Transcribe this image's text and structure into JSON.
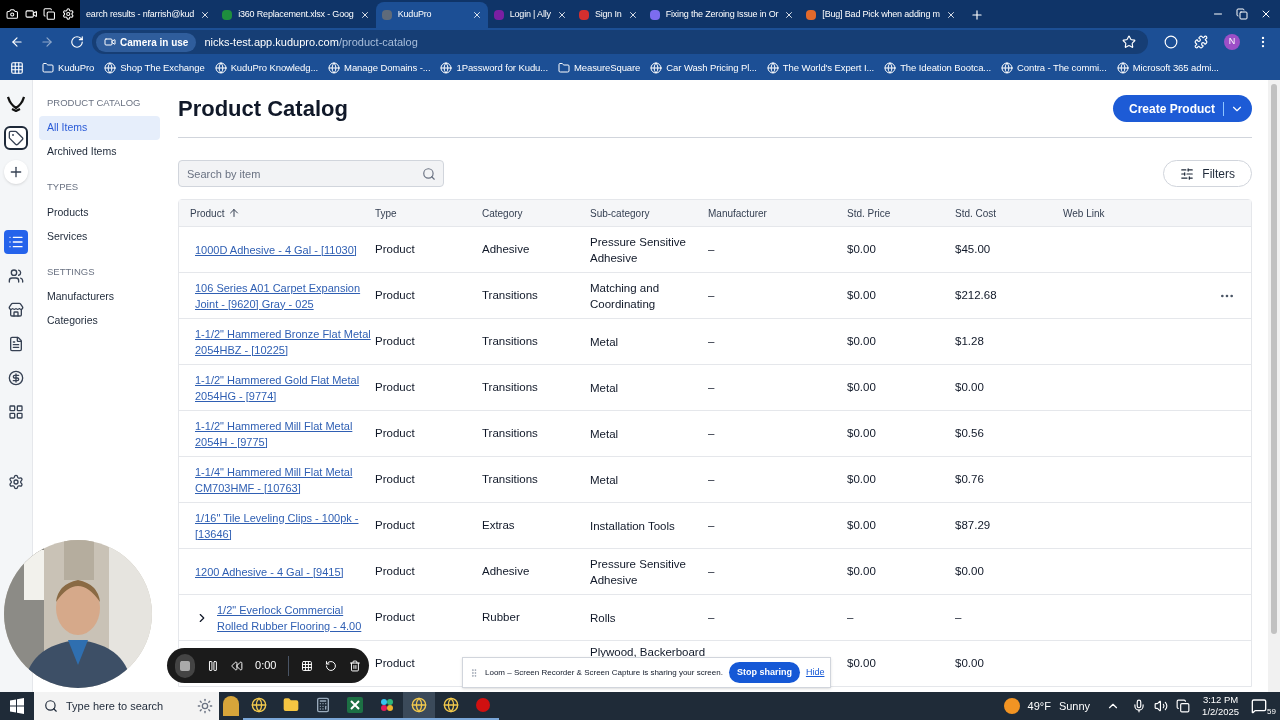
{
  "browser": {
    "tabs": [
      {
        "title": "earch results - nfarrish@kud",
        "selected": false
      },
      {
        "title": "i360 Replacement.xlsx - Goog",
        "selected": false,
        "color": "#1e8e3e"
      },
      {
        "title": "KuduPro",
        "selected": true,
        "color": "#5f6b7a"
      },
      {
        "title": "Login | Ally",
        "selected": false,
        "color": "#7b1fa2"
      },
      {
        "title": "Sign In",
        "selected": false,
        "color": "#d32f2f"
      },
      {
        "title": "Fixing the Zeroing Issue in Or",
        "selected": false,
        "color": "#7c6cf0"
      },
      {
        "title": "[Bug] Bad Pick when adding m",
        "selected": false,
        "color": "#e2692b"
      }
    ],
    "camera_chip": "Camera in use",
    "url_host": "nicks-test.app.kudupro.com",
    "url_path": "/product-catalog",
    "profile": "N",
    "bookmarks": [
      {
        "kind": "folder",
        "label": "KuduPro"
      },
      {
        "kind": "site",
        "label": "Shop The Exchange"
      },
      {
        "kind": "site",
        "label": "KuduPro Knowledg..."
      },
      {
        "kind": "site",
        "label": "Manage Domains -..."
      },
      {
        "kind": "site",
        "label": "1Password for Kudu..."
      },
      {
        "kind": "folder",
        "label": "MeasureSquare"
      },
      {
        "kind": "site",
        "label": "Car Wash Pricing Pl..."
      },
      {
        "kind": "site",
        "label": "The World's Expert I..."
      },
      {
        "kind": "site",
        "label": "The Ideation Bootca..."
      },
      {
        "kind": "site",
        "label": "Contra - The commi..."
      },
      {
        "kind": "site",
        "label": "Microsoft 365 admi..."
      }
    ]
  },
  "rail": [
    {
      "kind": "logo",
      "selected": false
    },
    {
      "kind": "tag",
      "selected": false
    },
    {
      "kind": "plus",
      "selected": false
    },
    {
      "kind": "list",
      "selected": true
    },
    {
      "kind": "users",
      "selected": false
    },
    {
      "kind": "store",
      "selected": false
    },
    {
      "kind": "file",
      "selected": false
    },
    {
      "kind": "dollar",
      "selected": false
    },
    {
      "kind": "grid",
      "selected": false
    },
    {
      "kind": "settings",
      "selected": false
    }
  ],
  "sidebar": [
    {
      "heading": "PRODUCT CATALOG",
      "items": [
        {
          "label": "All Items",
          "selected": true
        },
        {
          "label": "Archived Items",
          "selected": false
        }
      ]
    },
    {
      "heading": "TYPES",
      "items": [
        {
          "label": "Products",
          "selected": false
        },
        {
          "label": "Services",
          "selected": false
        }
      ]
    },
    {
      "heading": "SETTINGS",
      "items": [
        {
          "label": "Manufacturers",
          "selected": false
        },
        {
          "label": "Categories",
          "selected": false
        }
      ]
    }
  ],
  "page": {
    "title": "Product Catalog",
    "create_button": "Create Product",
    "search": {
      "placeholder": "Search by item"
    },
    "filters_button": "Filters"
  },
  "table": {
    "columns": [
      "Product",
      "Type",
      "Category",
      "Sub-category",
      "Manufacturer",
      "Std. Price",
      "Std. Cost",
      "Web Link"
    ],
    "rows": [
      {
        "product": "1000D Adhesive - 4 Gal - [11030]",
        "type": "Product",
        "category": "Adhesive",
        "subcategory": "Pressure Sensitive Adhesive",
        "manufacturer": "–",
        "price": "$0.00",
        "cost": "$45.00",
        "menu": false,
        "expandable": false
      },
      {
        "product": "106 Series A01 Carpet Expansion Joint - [9620] Gray - 025",
        "type": "Product",
        "category": "Transitions",
        "subcategory": "Matching and Coordinating",
        "manufacturer": "–",
        "price": "$0.00",
        "cost": "$212.68",
        "menu": true,
        "expandable": false
      },
      {
        "product": "1-1/2\" Hammered Bronze Flat Metal 2054HBZ - [10225]",
        "type": "Product",
        "category": "Transitions",
        "subcategory": "Metal",
        "manufacturer": "–",
        "price": "$0.00",
        "cost": "$1.28",
        "menu": false,
        "expandable": false
      },
      {
        "product": "1-1/2\" Hammered Gold Flat Metal 2054HG - [9774]",
        "type": "Product",
        "category": "Transitions",
        "subcategory": "Metal",
        "manufacturer": "–",
        "price": "$0.00",
        "cost": "$0.00",
        "menu": false,
        "expandable": false
      },
      {
        "product": "1-1/2\" Hammered Mill Flat Metal 2054H - [9775]",
        "type": "Product",
        "category": "Transitions",
        "subcategory": "Metal",
        "manufacturer": "–",
        "price": "$0.00",
        "cost": "$0.56",
        "menu": false,
        "expandable": false
      },
      {
        "product": "1-1/4\" Hammered Mill Flat Metal CM703HMF - [10763]",
        "type": "Product",
        "category": "Transitions",
        "subcategory": "Metal",
        "manufacturer": "–",
        "price": "$0.00",
        "cost": "$0.76",
        "menu": false,
        "expandable": false
      },
      {
        "product": "1/16\" Tile Leveling Clips - 100pk - [13646]",
        "type": "Product",
        "category": "Extras",
        "subcategory": "Installation Tools",
        "manufacturer": "–",
        "price": "$0.00",
        "cost": "$87.29",
        "menu": false,
        "expandable": false
      },
      {
        "product": "1200 Adhesive - 4 Gal - [9415]",
        "type": "Product",
        "category": "Adhesive",
        "subcategory": "Pressure Sensitive Adhesive",
        "manufacturer": "–",
        "price": "$0.00",
        "cost": "$0.00",
        "menu": false,
        "expandable": false
      },
      {
        "product": "1/2\" Everlock Commercial Rolled Rubber Flooring - 4.00",
        "type": "Product",
        "category": "Rubber",
        "subcategory": "Rolls",
        "manufacturer": "–",
        "price": "–",
        "cost": "–",
        "menu": false,
        "expandable": true,
        "expanded": false
      },
      {
        "type": "Product",
        "subcategory": "Plywood, Backerboard",
        "price": "$0.00",
        "cost": "$0.00",
        "menu": false,
        "expandable": false
      }
    ]
  },
  "recorder": {
    "time": "0:00"
  },
  "share_banner": {
    "message": "Loom – Screen Recorder & Screen Capture is sharing your screen.",
    "stop_button": "Stop sharing",
    "hide_link": "Hide"
  },
  "taskbar": {
    "search": {
      "placeholder": "Type here to search"
    },
    "apps": [
      {
        "kind": "browser",
        "selected": false
      },
      {
        "kind": "folder",
        "selected": false
      },
      {
        "kind": "calculator",
        "selected": false
      },
      {
        "kind": "spreadsheet",
        "selected": false
      },
      {
        "kind": "chat",
        "selected": false
      },
      {
        "kind": "browser",
        "selected": true
      },
      {
        "kind": "browser",
        "selected": false
      },
      {
        "kind": "record",
        "selected": false
      }
    ],
    "temperature": "49°F",
    "weather": "Sunny",
    "time": "3:12 PM",
    "date": "1/2/2025",
    "notifications": "59"
  }
}
